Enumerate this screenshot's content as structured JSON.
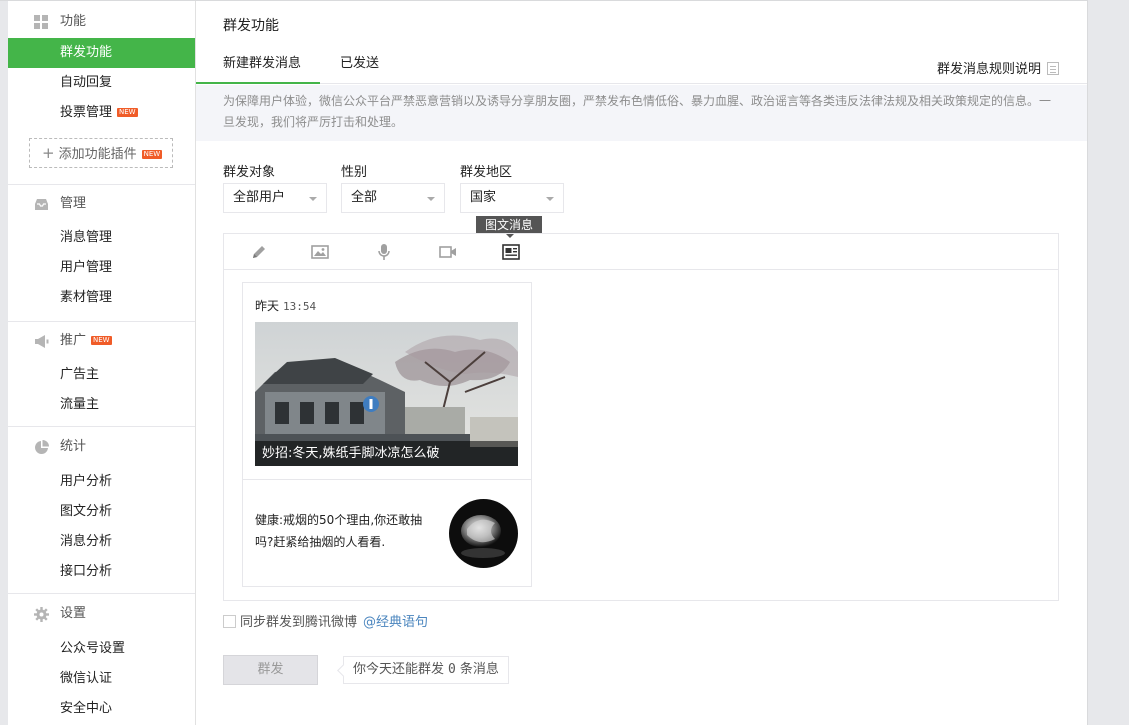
{
  "sidebar": {
    "groups": [
      {
        "title": "功能",
        "icon": "grid-icon",
        "items": [
          {
            "label": "群发功能",
            "active": true
          },
          {
            "label": "自动回复"
          },
          {
            "label": "投票管理",
            "badge": "NEW"
          }
        ],
        "add_plugin": "添加功能插件",
        "add_plugin_badge": "NEW"
      },
      {
        "title": "管理",
        "icon": "inbox-icon",
        "items": [
          {
            "label": "消息管理"
          },
          {
            "label": "用户管理"
          },
          {
            "label": "素材管理"
          }
        ]
      },
      {
        "title": "推广",
        "icon": "megaphone-icon",
        "title_badge": "NEW",
        "items": [
          {
            "label": "广告主"
          },
          {
            "label": "流量主"
          }
        ]
      },
      {
        "title": "统计",
        "icon": "pie-chart-icon",
        "items": [
          {
            "label": "用户分析"
          },
          {
            "label": "图文分析"
          },
          {
            "label": "消息分析"
          },
          {
            "label": "接口分析"
          }
        ]
      },
      {
        "title": "设置",
        "icon": "gear-icon",
        "items": [
          {
            "label": "公众号设置"
          },
          {
            "label": "微信认证"
          },
          {
            "label": "安全中心"
          }
        ]
      }
    ]
  },
  "main": {
    "title": "群发功能",
    "tabs": [
      {
        "label": "新建群发消息",
        "active": true
      },
      {
        "label": "已发送"
      }
    ],
    "rule_link": "群发消息规则说明",
    "notice": "为保障用户体验，微信公众平台严禁恶意营销以及诱导分享朋友圈，严禁发布色情低俗、暴力血腥、政治谣言等各类违反法律法规及相关政策规定的信息。一旦发现，我们将严厉打击和处理。",
    "filters": {
      "target": {
        "label": "群发对象",
        "value": "全部用户"
      },
      "gender": {
        "label": "性别",
        "value": "全部"
      },
      "region": {
        "label": "群发地区",
        "value": "国家"
      }
    },
    "tooltip": "图文消息",
    "toolbar": [
      "pencil-icon",
      "image-icon",
      "microphone-icon",
      "video-icon",
      "news-icon"
    ],
    "card": {
      "date": "昨天",
      "time": "13:54",
      "cover_title": "妙招:冬天,姝纸手脚冰凉怎么破",
      "sub_title": "健康:戒烟的50个理由,你还敢抽吗?赶紧给抽烟的人看看."
    },
    "sync": {
      "label": "同步群发到腾讯微博",
      "link": "@经典语句"
    },
    "send_button": "群发",
    "quota": {
      "prefix": "你今天还能群发",
      "count": "0",
      "suffix": "条消息"
    }
  },
  "colors": {
    "accent": "#44b549",
    "link": "#4a85be",
    "badge": "#f05c28"
  }
}
